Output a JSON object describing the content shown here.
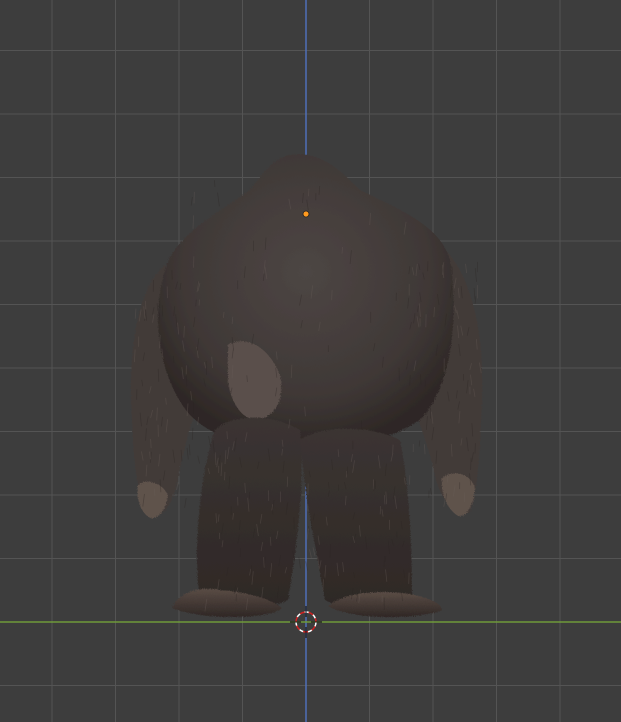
{
  "viewport": {
    "background": "#3d3d3d",
    "grid_color": "#545454",
    "axis_vertical_color": "#4f6fb8",
    "axis_horizontal_color": "#6f9a3a",
    "origin_point_color": "#ff9a1f"
  },
  "scene": {
    "object_name": "sasquatch-model",
    "fur_color": "#4a4240"
  },
  "icons": {
    "origin": "origin-dot-icon",
    "cursor": "3d-cursor-icon"
  }
}
